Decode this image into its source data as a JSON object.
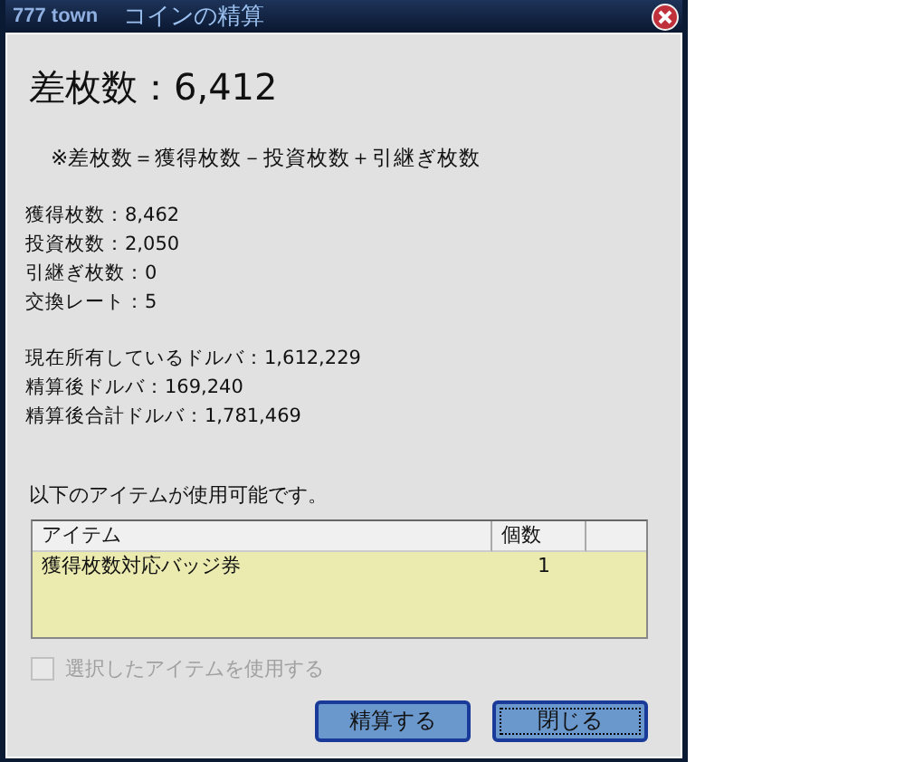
{
  "window": {
    "brand": "777 town",
    "title": "コインの精算"
  },
  "heading": "差枚数：6,412",
  "formula": "※差枚数＝獲得枚数－投資枚数＋引継ぎ枚数",
  "stats": [
    "獲得枚数：8,462",
    "投資枚数：2,050",
    "引継ぎ枚数：0",
    "交換レート：5"
  ],
  "dollars": [
    "現在所有しているドルバ：1,612,229",
    "精算後ドルバ：169,240",
    "精算後合計ドルバ：1,781,469"
  ],
  "items_caption": "以下のアイテムが使用可能です。",
  "table": {
    "columns": [
      "アイテム",
      "個数"
    ],
    "rows": [
      {
        "cells": [
          "獲得枚数対応バッジ券",
          "1"
        ]
      }
    ]
  },
  "use_item": {
    "label": "選択したアイテムを使用する",
    "checked": false,
    "disabled": true
  },
  "buttons": [
    {
      "label": "精算する",
      "focused": false
    },
    {
      "label": "閉じる",
      "focused": true
    }
  ]
}
